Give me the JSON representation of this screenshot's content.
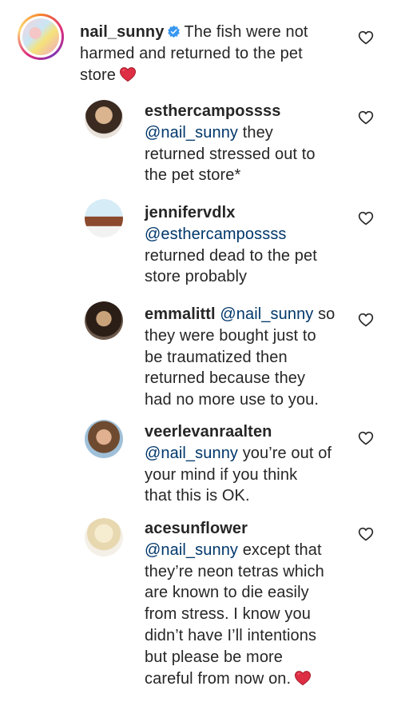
{
  "comments": [
    {
      "username": "nail_sunny",
      "verified": true,
      "lines": [
        "The fish were not",
        "harmed and returned to the pet",
        "store"
      ],
      "emoji": "red-heart",
      "avatar": "profile-photo"
    },
    {
      "username": "esthercampossss",
      "mention": "@nail_sunny",
      "lines": [
        "they",
        "returned stressed out to",
        "the pet store*"
      ]
    },
    {
      "username": "jennifervdlx",
      "mention": "@esthercampossss",
      "lines": [
        "returned dead to the pet",
        "store probably"
      ]
    },
    {
      "username": "emmalittl",
      "mention": "@nail_sunny",
      "lines": [
        "so",
        "they were bought just to",
        "be traumatized then",
        "returned because they",
        "had no more use to you."
      ]
    },
    {
      "username": "veerlevanraalten",
      "mention": "@nail_sunny",
      "lines": [
        "you’re out of",
        "your mind if you think",
        "that this is OK."
      ]
    },
    {
      "username": "acesunflower",
      "mention": "@nail_sunny",
      "lines": [
        "except that",
        "they’re neon tetras which",
        "are known to die easily",
        "from stress. I know you",
        "didn’t have I’ll intentions",
        "but please be more",
        "careful from now on."
      ],
      "emoji": "red-heart"
    }
  ],
  "icons": {
    "like": "heart-outline-icon",
    "verified": "verified-badge-icon"
  },
  "colors": {
    "text": "#262626",
    "mention": "#00376b",
    "verified": "#3897f0",
    "heart": "#ed4956"
  }
}
